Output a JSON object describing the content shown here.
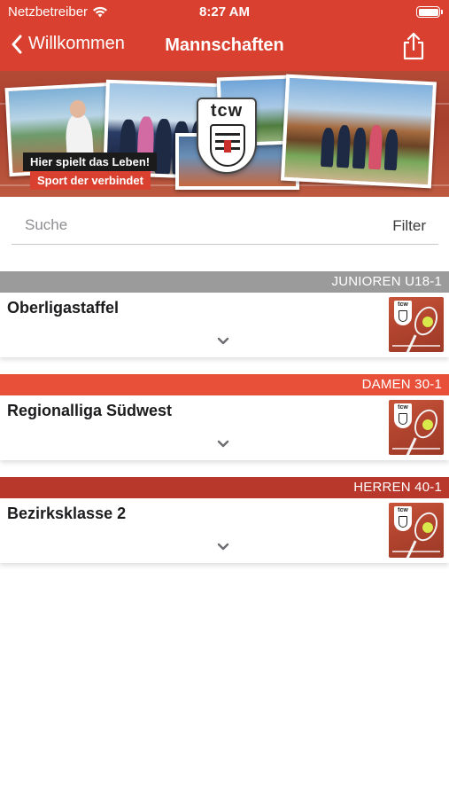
{
  "status_bar": {
    "carrier": "Netzbetreiber",
    "time": "8:27 AM"
  },
  "nav": {
    "back_label": "Willkommen",
    "title": "Mannschaften"
  },
  "banner": {
    "logo_text": "tcw",
    "tagline_1": "Hier spielt das Leben!",
    "tagline_2": "Sport der verbindet"
  },
  "search": {
    "placeholder": "Suche",
    "filter_label": "Filter"
  },
  "teams": [
    {
      "category": "JUNIOREN U18-1",
      "league": "Oberligastaffel",
      "header_color": "#9b9b9b"
    },
    {
      "category": "DAMEN 30-1",
      "league": "Regionalliga Südwest",
      "header_color": "#e8503a"
    },
    {
      "category": "HERREN 40-1",
      "league": "Bezirksklasse 2",
      "header_color": "#b8382b"
    }
  ],
  "colors": {
    "brand_red": "#d9402f"
  },
  "icons": {
    "back": "chevron-left-icon",
    "share": "share-icon",
    "expand": "chevron-down-icon",
    "wifi": "wifi-icon",
    "battery": "battery-icon"
  }
}
